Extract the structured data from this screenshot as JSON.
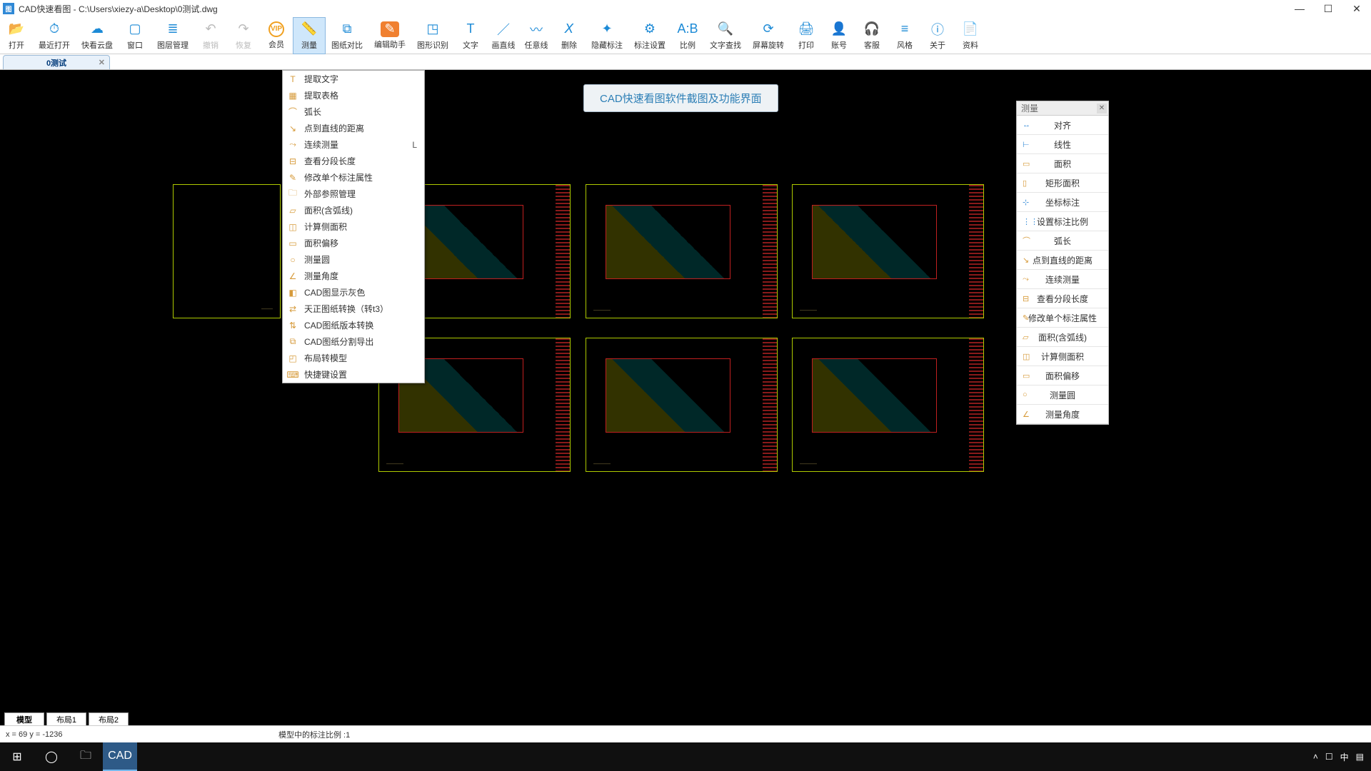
{
  "window": {
    "title": "CAD快速看图 - C:\\Users\\xiezy-a\\Desktop\\0测试.dwg",
    "icon_text": "图"
  },
  "toolbar": [
    {
      "id": "open",
      "label": "打开",
      "glyph": "📂"
    },
    {
      "id": "recent",
      "label": "最近打开",
      "glyph": "⏱",
      "wide": true
    },
    {
      "id": "cloud",
      "label": "快看云盘",
      "glyph": "☁",
      "wide": true
    },
    {
      "id": "window",
      "label": "窗口",
      "glyph": "▢"
    },
    {
      "id": "layer",
      "label": "图层管理",
      "glyph": "≣",
      "wide": true
    },
    {
      "id": "undo",
      "label": "撤销",
      "glyph": "↶",
      "disabled": true
    },
    {
      "id": "redo",
      "label": "恢复",
      "glyph": "↷",
      "disabled": true
    },
    {
      "id": "vip",
      "label": "会员",
      "glyph": "VIP",
      "vip": true
    },
    {
      "id": "measure",
      "label": "测量",
      "glyph": "📏",
      "active": true
    },
    {
      "id": "compare",
      "label": "图纸对比",
      "glyph": "⧉",
      "wide": true
    },
    {
      "id": "editor",
      "label": "编辑助手",
      "glyph": "✎",
      "wide": true,
      "orange_bg": true
    },
    {
      "id": "shape",
      "label": "图形识别",
      "glyph": "◳",
      "wide": true
    },
    {
      "id": "text",
      "label": "文字",
      "glyph": "T"
    },
    {
      "id": "line",
      "label": "画直线",
      "glyph": "／"
    },
    {
      "id": "freeline",
      "label": "任意线",
      "glyph": "〰"
    },
    {
      "id": "delete",
      "label": "删除",
      "glyph": "𝘟"
    },
    {
      "id": "hidemark",
      "label": "隐藏标注",
      "glyph": "✦",
      "wide": true
    },
    {
      "id": "markset",
      "label": "标注设置",
      "glyph": "⚙",
      "wide": true
    },
    {
      "id": "ratio",
      "label": "比例",
      "glyph": "A:B"
    },
    {
      "id": "findtext",
      "label": "文字查找",
      "glyph": "🔍",
      "wide": true
    },
    {
      "id": "rotate",
      "label": "屏幕旋转",
      "glyph": "⟳",
      "wide": true
    },
    {
      "id": "print",
      "label": "打印",
      "glyph": "🖨"
    },
    {
      "id": "account",
      "label": "账号",
      "glyph": "👤"
    },
    {
      "id": "support",
      "label": "客服",
      "glyph": "🎧"
    },
    {
      "id": "style",
      "label": "风格",
      "glyph": "≡"
    },
    {
      "id": "about",
      "label": "关于",
      "glyph": "ⓘ"
    },
    {
      "id": "docs",
      "label": "资料",
      "glyph": "📄"
    }
  ],
  "doctab": {
    "label": "0测试"
  },
  "note": "CAD快速看图软件截图及功能界面",
  "dropdown": [
    {
      "label": "提取文字",
      "icon": "T"
    },
    {
      "label": "提取表格",
      "icon": "▦"
    },
    {
      "label": "弧长",
      "icon": "⌒"
    },
    {
      "label": "点到直线的距离",
      "icon": "↘"
    },
    {
      "label": "连续测量",
      "icon": "⤳",
      "shortcut": "L"
    },
    {
      "label": "查看分段长度",
      "icon": "⊟"
    },
    {
      "label": "修改单个标注属性",
      "icon": "✎"
    },
    {
      "label": "外部参照管理",
      "icon": "🗀"
    },
    {
      "label": "面积(含弧线)",
      "icon": "▱"
    },
    {
      "label": "计算侧面积",
      "icon": "◫"
    },
    {
      "label": "面积偏移",
      "icon": "▭"
    },
    {
      "label": "测量圆",
      "icon": "○"
    },
    {
      "label": "测量角度",
      "icon": "∠"
    },
    {
      "label": "CAD图显示灰色",
      "icon": "◧"
    },
    {
      "label": "天正图纸转换（转t3）",
      "icon": "⇄"
    },
    {
      "label": "CAD图纸版本转换",
      "icon": "⇅"
    },
    {
      "label": "CAD图纸分割导出",
      "icon": "⧉"
    },
    {
      "label": "布局转模型",
      "icon": "◰"
    },
    {
      "label": "快捷键设置",
      "icon": "⌨"
    }
  ],
  "right_panel": {
    "header": "测量",
    "items": [
      {
        "label": "对齐",
        "icon": "↔",
        "blue": true
      },
      {
        "label": "线性",
        "icon": "⊢",
        "blue": true
      },
      {
        "label": "面积",
        "icon": "▭"
      },
      {
        "label": "矩形面积",
        "icon": "▯"
      },
      {
        "label": "坐标标注",
        "icon": "⊹",
        "blue": true
      },
      {
        "label": "设置标注比例",
        "icon": "⋮⋮",
        "blue": true
      },
      {
        "label": "弧长",
        "icon": "⌒"
      },
      {
        "label": "点到直线的距离",
        "icon": "↘"
      },
      {
        "label": "连续测量",
        "icon": "⤳"
      },
      {
        "label": "查看分段长度",
        "icon": "⊟"
      },
      {
        "label": "修改单个标注属性",
        "icon": "✎"
      },
      {
        "label": "面积(含弧线)",
        "icon": "▱"
      },
      {
        "label": "计算侧面积",
        "icon": "◫"
      },
      {
        "label": "面积偏移",
        "icon": "▭"
      },
      {
        "label": "测量圆",
        "icon": "○"
      },
      {
        "label": "测量角度",
        "icon": "∠"
      }
    ]
  },
  "layout_tabs": [
    "模型",
    "布局1",
    "布局2"
  ],
  "status": {
    "coords": "x = 69  y = -1236",
    "scale": "模型中的标注比例 :1"
  },
  "tray": {
    "ime1": "☐",
    "ime2": "中",
    "ime3": "▤"
  }
}
